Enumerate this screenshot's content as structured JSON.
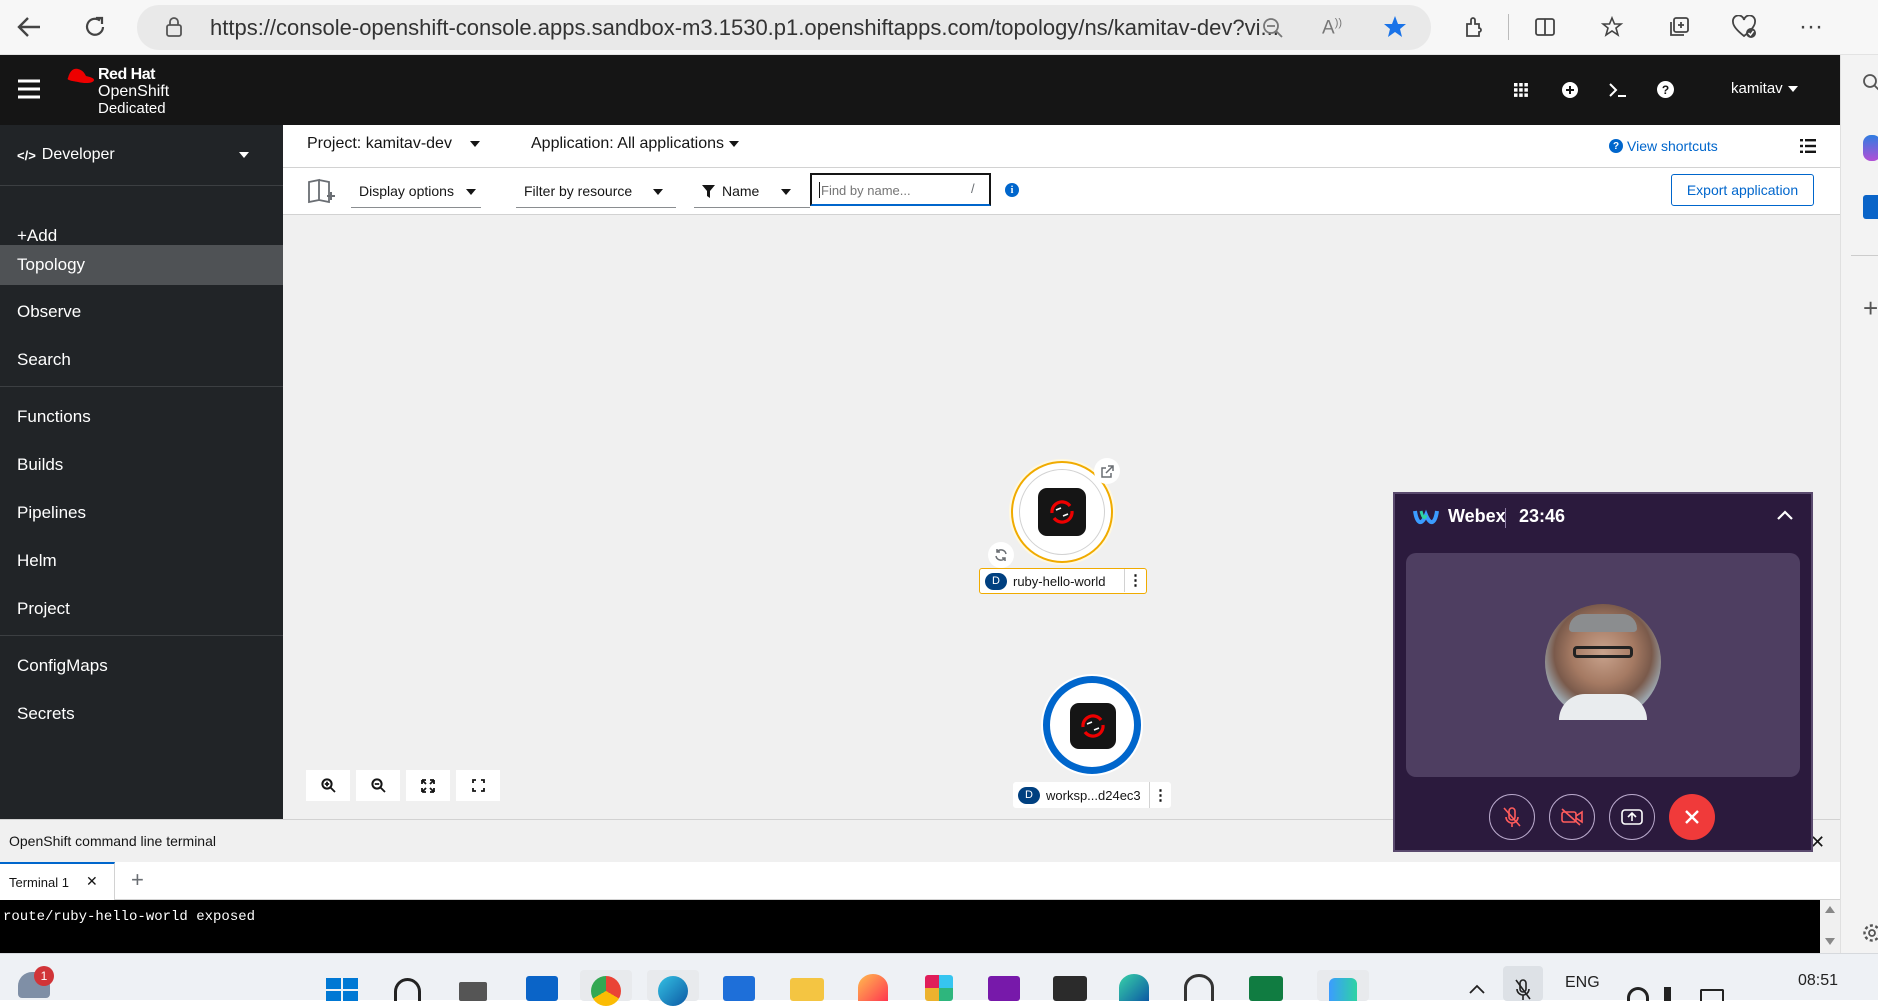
{
  "browser": {
    "url": "https://console-openshift-console.apps.sandbox-m3.1530.p1.openshiftapps.com/topology/ns/kamitav-dev?vi..."
  },
  "masthead": {
    "brand_line1": "Red Hat",
    "brand_line2": "OpenShift",
    "brand_line3": "Dedicated",
    "user": "kamitav"
  },
  "sidebar": {
    "perspective": "Developer",
    "items": [
      {
        "label": "+Add"
      },
      {
        "label": "Topology",
        "active": true
      },
      {
        "label": "Observe"
      },
      {
        "label": "Search"
      },
      {
        "label": "Functions"
      },
      {
        "label": "Builds"
      },
      {
        "label": "Pipelines"
      },
      {
        "label": "Helm"
      },
      {
        "label": "Project"
      },
      {
        "label": "ConfigMaps"
      },
      {
        "label": "Secrets"
      }
    ]
  },
  "projectbar": {
    "project": "Project: kamitav-dev",
    "application": "Application: All applications",
    "shortcuts": "View shortcuts"
  },
  "toolbar": {
    "display_options": "Display options",
    "filter_by_resource": "Filter by resource",
    "filter_name": "Name",
    "search_placeholder": "Find by name...",
    "search_shortcut": "/",
    "export": "Export application"
  },
  "topology": {
    "nodes": [
      {
        "name": "ruby-hello-world",
        "badge": "D",
        "ring_color": "#f0ab00"
      },
      {
        "name": "worksp...d24ec3",
        "badge": "D",
        "ring_color": "#0066cc"
      }
    ]
  },
  "terminal": {
    "title": "OpenShift command line terminal",
    "tab": "Terminal 1",
    "output": "route/ruby-hello-world exposed"
  },
  "webex": {
    "title": "Webex",
    "timer": "23:46"
  },
  "taskbar": {
    "notification_count": "1",
    "language": "ENG",
    "time": "08:51"
  }
}
